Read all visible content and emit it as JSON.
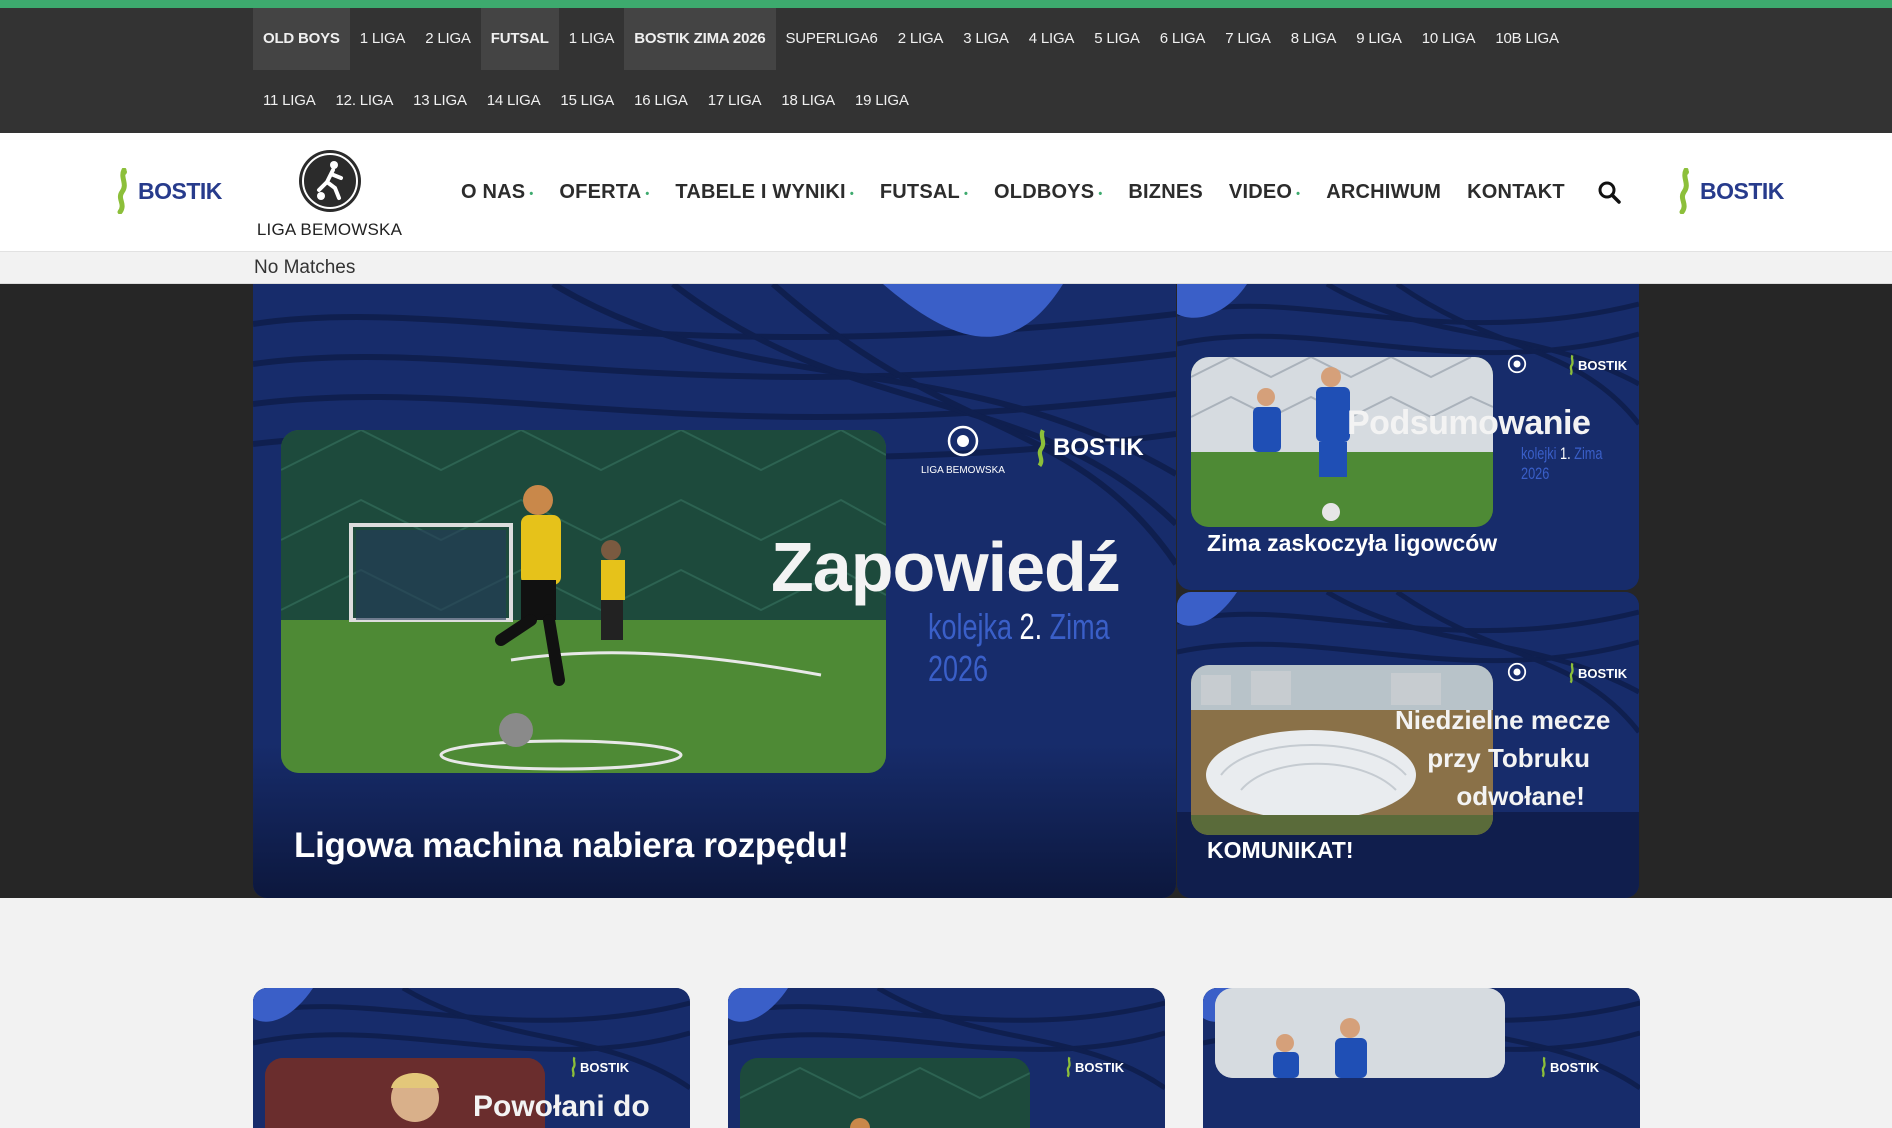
{
  "leagues_row1": [
    {
      "label": "OLD BOYS",
      "bold": true,
      "hl": true
    },
    {
      "label": "1 LIGA"
    },
    {
      "label": "2 LIGA"
    },
    {
      "label": "FUTSAL",
      "bold": true,
      "hl": true
    },
    {
      "label": "1 LIGA"
    },
    {
      "label": "BOSTIK ZIMA 2026",
      "bold": true,
      "hl": true
    },
    {
      "label": "SUPERLIGA6"
    },
    {
      "label": "2 LIGA"
    },
    {
      "label": "3 LIGA"
    },
    {
      "label": "4 LIGA"
    },
    {
      "label": "5 LIGA"
    },
    {
      "label": "6 LIGA"
    },
    {
      "label": "7 LIGA"
    },
    {
      "label": "8 LIGA"
    },
    {
      "label": "9 LIGA"
    },
    {
      "label": "10 LIGA"
    },
    {
      "label": "10B LIGA"
    }
  ],
  "leagues_row2": [
    {
      "label": "11 LIGA"
    },
    {
      "label": "12. LIGA"
    },
    {
      "label": "13 LIGA"
    },
    {
      "label": "14 LIGA"
    },
    {
      "label": "15 LIGA"
    },
    {
      "label": "16 LIGA"
    },
    {
      "label": "17 LIGA"
    },
    {
      "label": "18 LIGA"
    },
    {
      "label": "19 LIGA"
    }
  ],
  "sponsor": "BOSTIK",
  "logo_name": "LIGA BEMOWSKA",
  "menu": [
    {
      "label": "O NAS",
      "dropdown": true
    },
    {
      "label": "OFERTA",
      "dropdown": true
    },
    {
      "label": "TABELE I WYNIKI",
      "dropdown": true
    },
    {
      "label": "FUTSAL",
      "dropdown": true
    },
    {
      "label": "OLDBOYS",
      "dropdown": true
    },
    {
      "label": "BIZNES",
      "dropdown": false
    },
    {
      "label": "VIDEO",
      "dropdown": true
    },
    {
      "label": "ARCHIWUM",
      "dropdown": false
    },
    {
      "label": "KONTAKT",
      "dropdown": false
    }
  ],
  "ticker": "No Matches",
  "hero": {
    "main": {
      "graphic_title": "Zapowiedź",
      "graphic_subtitle_a": "kolejka",
      "graphic_subtitle_num": "2.",
      "graphic_subtitle_b": "Zima 2026",
      "caption": "Ligowa machina nabiera rozpędu!"
    },
    "side1": {
      "graphic_title": "Podsumowanie",
      "graphic_subtitle_a": "kolejki",
      "graphic_subtitle_num": "1.",
      "graphic_subtitle_b": "Zima 2026",
      "caption": "Zima zaskoczyła ligowców"
    },
    "side2": {
      "graphic_line1": "Niedzielne mecze",
      "graphic_line2": "przy Tobruku",
      "graphic_line3": "odwołane!",
      "caption": "KOMUNIKAT!"
    }
  },
  "bottom_cards": [
    {
      "graphic_title": "Powołani do"
    },
    {
      "graphic_title": ""
    },
    {
      "graphic_title": ""
    }
  ],
  "colors": {
    "accent": "#3daa6e",
    "navy": "#152a66",
    "bostik_blue": "#273b8c",
    "topbar": "#333333"
  }
}
